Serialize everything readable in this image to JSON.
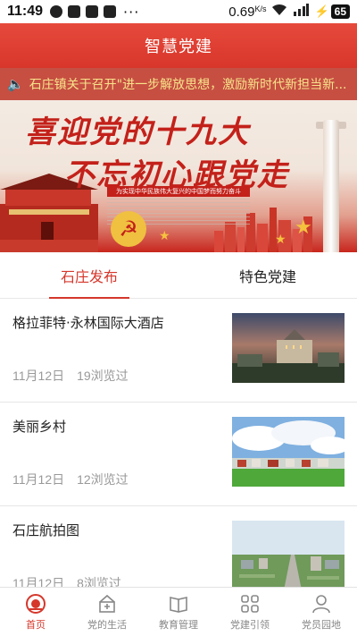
{
  "status_bar": {
    "time": "11:49",
    "left_icons": [
      "chat-icon",
      "lock-app-icon",
      "heart-app-icon",
      "news-app-icon"
    ],
    "more": "···",
    "speed": "0.69",
    "speed_unit": "K/s",
    "battery": "65"
  },
  "header": {
    "title": "智慧党建"
  },
  "banner": {
    "marquee": "石庄镇关于召开\"进一步解放思想，激励新时代新担当新...",
    "slogan_line1": "喜迎党的十九大",
    "slogan_line2": "不忘初心跟党走",
    "caption": "为实现中华民族伟大复兴的中国梦而努力奋斗"
  },
  "tabs": [
    {
      "label": "石庄发布",
      "active": true
    },
    {
      "label": "特色党建",
      "active": false
    }
  ],
  "articles": [
    {
      "title": "格拉菲特·永林国际大酒店",
      "date": "11月12日",
      "views": "19浏览过"
    },
    {
      "title": "美丽乡村",
      "date": "11月12日",
      "views": "12浏览过"
    },
    {
      "title": "石庄航拍图",
      "date": "11月12日",
      "views": "8浏览过"
    }
  ],
  "bottom_nav": [
    {
      "label": "首页",
      "icon": "home-emblem-icon",
      "active": true
    },
    {
      "label": "党的生活",
      "icon": "party-life-icon",
      "active": false
    },
    {
      "label": "教育管理",
      "icon": "book-icon",
      "active": false
    },
    {
      "label": "党建引领",
      "icon": "grid-icon",
      "active": false
    },
    {
      "label": "党员园地",
      "icon": "person-icon",
      "active": false
    }
  ],
  "colors": {
    "brand_red": "#d5372b",
    "marquee_text": "#f7e38a",
    "inactive_gray": "#888888"
  }
}
